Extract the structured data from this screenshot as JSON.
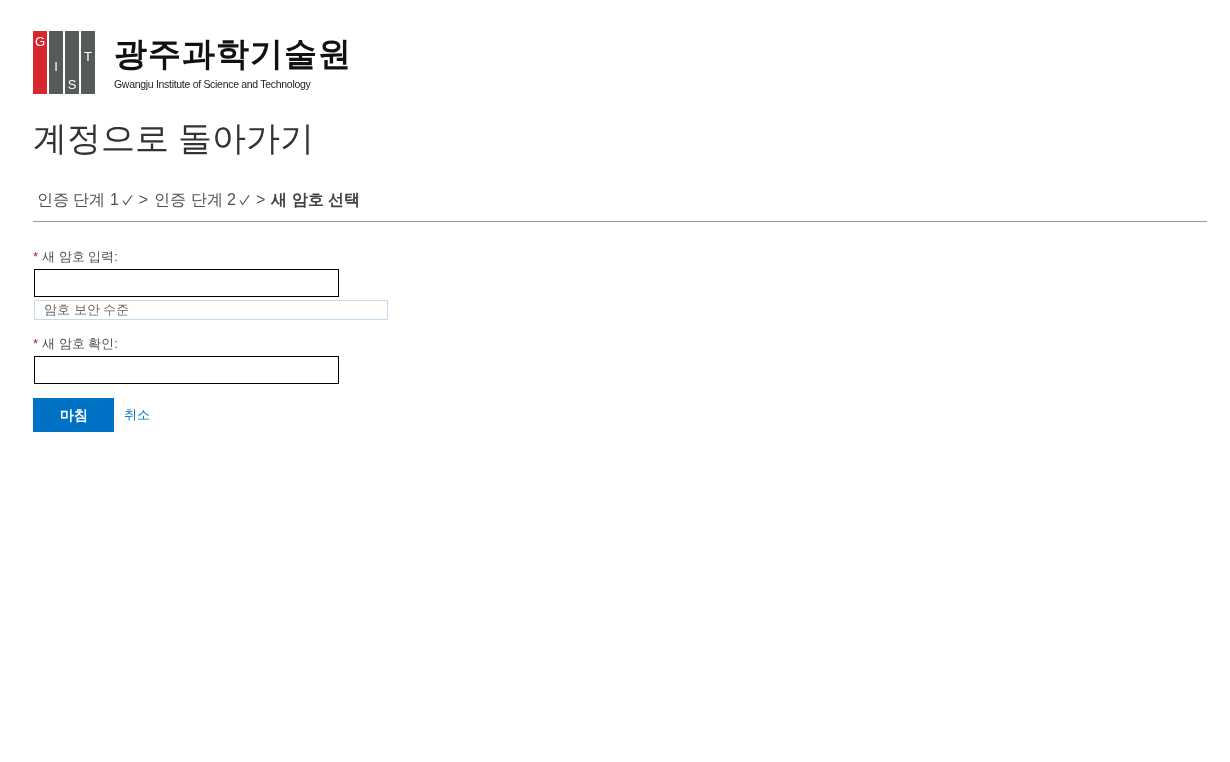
{
  "logo": {
    "emblem": [
      {
        "letter": "G",
        "color": "#d7262e"
      },
      {
        "letter": "I",
        "color": "#575b57"
      },
      {
        "letter": "S",
        "color": "#575b57"
      },
      {
        "letter": "T",
        "color": "#575b57"
      }
    ],
    "name": "광주과학기술원",
    "subtitle": "Gwangju Institute of Science and Technology"
  },
  "heading": "계정으로 돌아가기",
  "steps": [
    {
      "label": "인증 단계 1",
      "done": true,
      "selected": false
    },
    {
      "label": "인증 단계 2",
      "done": true,
      "selected": false
    },
    {
      "label": "새 암호 선택",
      "done": false,
      "selected": true
    }
  ],
  "step_separators": [
    ">",
    ">"
  ],
  "fields": [
    {
      "required_mark": "*",
      "label": "새 암호 입력:",
      "strength_meter": {
        "label": "암호 보안 수준"
      }
    },
    {
      "required_mark": "*",
      "label": "새 암호 확인:"
    }
  ],
  "buttons": [
    {
      "label": "마침",
      "kind": "primary"
    },
    {
      "label": "취소",
      "kind": "link"
    }
  ]
}
